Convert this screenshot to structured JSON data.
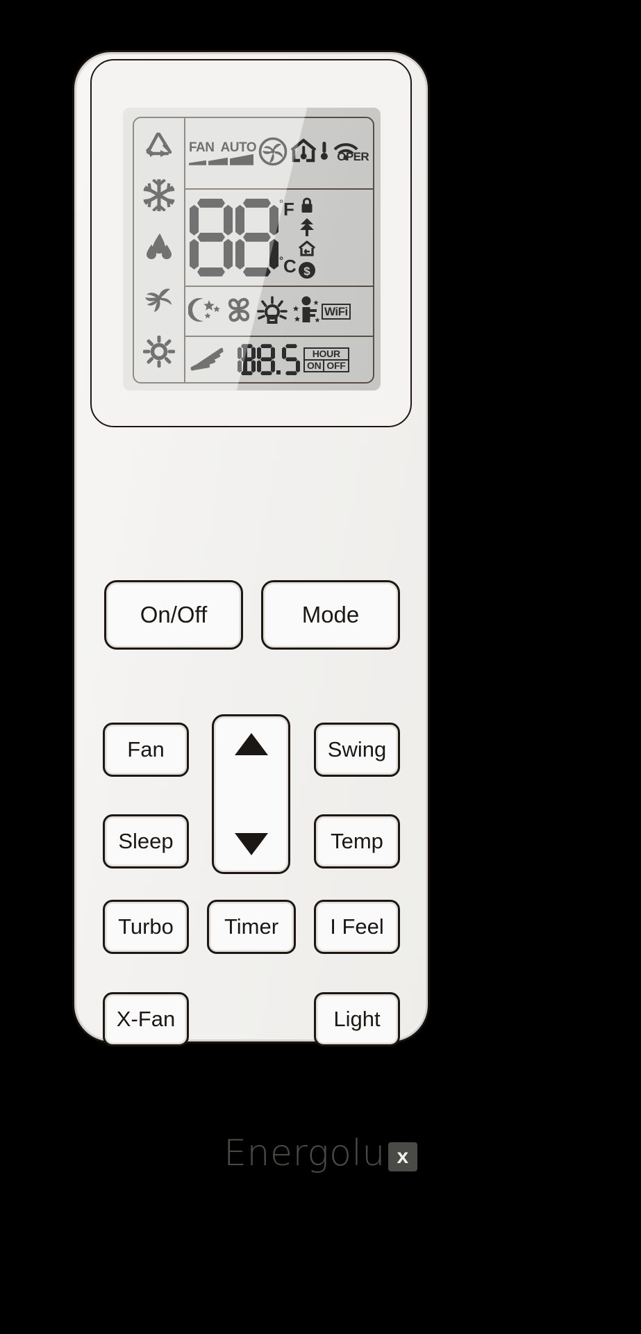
{
  "device": {
    "brand": "Energolu",
    "brand_badge": "x",
    "type": "air-conditioner-remote"
  },
  "display": {
    "mode_icons": [
      {
        "name": "auto-mode-icon",
        "label": "AUTO"
      },
      {
        "name": "cool-mode-snowflake-icon",
        "label": "COOL"
      },
      {
        "name": "dry-mode-droplet-icon",
        "label": "DRY"
      },
      {
        "name": "fan-mode-icon",
        "label": "FAN"
      },
      {
        "name": "heat-mode-sun-icon",
        "label": "HEAT"
      }
    ],
    "top_row": {
      "fan_label": "FAN",
      "auto_label": "AUTO",
      "fan_speed_bars": 3,
      "icons": [
        {
          "name": "fan-blades-icon"
        },
        {
          "name": "indoor-temperature-house-icon"
        },
        {
          "name": "outdoor-thermometer-icon"
        },
        {
          "name": "wifi-signal-icon"
        }
      ],
      "oper_label": "OPER"
    },
    "temperature": {
      "digit_left": "8",
      "digit_right": "8",
      "value": "88",
      "unit_fahrenheit": "F",
      "unit_celsius": "C",
      "degree_symbol": "°",
      "side_icons": [
        {
          "name": "lock-icon"
        },
        {
          "name": "tree-energy-saving-icon"
        },
        {
          "name": "home-return-icon"
        },
        {
          "name": "dollar-saving-icon"
        }
      ]
    },
    "function_row": {
      "icons": [
        {
          "name": "sleep-moon-stars-icon"
        },
        {
          "name": "x-fan-clover-icon"
        },
        {
          "name": "light-bulb-icon"
        },
        {
          "name": "i-feel-person-icon"
        }
      ],
      "wifi_label": "WiFi"
    },
    "timer_row": {
      "swing-icon": "swing-louver-icon",
      "timer_value": "88.5",
      "timer_digits": [
        "8",
        "8",
        "5"
      ],
      "hour_label": "HOUR",
      "on_label": "ON",
      "off_label": "OFF"
    }
  },
  "buttons": {
    "row1": [
      {
        "name": "on-off-button",
        "label": "On/Off"
      },
      {
        "name": "mode-button",
        "label": "Mode"
      }
    ],
    "left_column": [
      {
        "name": "fan-button",
        "label": "Fan"
      },
      {
        "name": "sleep-button",
        "label": "Sleep"
      },
      {
        "name": "turbo-button",
        "label": "Turbo"
      },
      {
        "name": "x-fan-button",
        "label": "X-Fan"
      }
    ],
    "center_column": [
      {
        "name": "timer-button",
        "label": "Timer"
      }
    ],
    "right_column": [
      {
        "name": "swing-button",
        "label": "Swing"
      },
      {
        "name": "temp-button",
        "label": "Temp"
      },
      {
        "name": "i-feel-button",
        "label": "I Feel"
      },
      {
        "name": "light-button",
        "label": "Light"
      }
    ],
    "stepper": {
      "name": "temperature-stepper",
      "up_icon": "triangle-up-icon",
      "down_icon": "triangle-down-icon"
    }
  },
  "colors": {
    "body": "#f2f1ef",
    "outline": "#1b1714",
    "lcd": "#d6d6d4",
    "lcd_ink": "#141414",
    "logo": "#4a4a47"
  }
}
